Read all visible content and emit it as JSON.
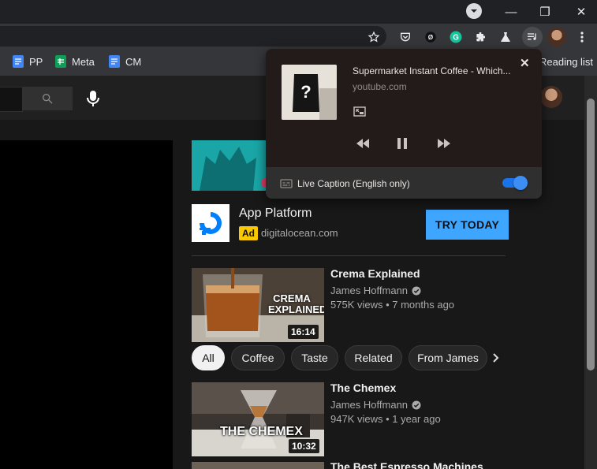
{
  "window": {
    "minimize": "—",
    "restore": "❐",
    "close": "✕"
  },
  "bookmarks": [
    {
      "label": "PP",
      "color": "#4285f4"
    },
    {
      "label": "Meta",
      "color": "#0f9d58"
    },
    {
      "label": "CM",
      "color": "#4285f4"
    }
  ],
  "reading_list": "Reading list",
  "media_popup": {
    "title": "Supermarket Instant Coffee - Which...",
    "source": "youtube.com",
    "live_caption_label": "Live Caption (English only)",
    "live_caption_on": true,
    "close": "✕"
  },
  "ad": {
    "title": "App Platform",
    "badge": "Ad",
    "domain": "digitalocean.com",
    "cta": "TRY TODAY"
  },
  "videos": [
    {
      "title": "Crema Explained",
      "channel": "James Hoffmann",
      "meta": "575K views • 7 months ago",
      "duration": "16:14",
      "overlay": "CREMA EXPLAINED"
    },
    {
      "title": "The Chemex",
      "channel": "James Hoffmann",
      "meta": "947K views • 1 year ago",
      "duration": "10:32",
      "overlay": "THE CHEMEX"
    },
    {
      "title": "The Best Espresso Machines"
    }
  ],
  "chips": [
    "All",
    "Coffee",
    "Taste",
    "Related",
    "From James"
  ],
  "colors": {
    "accent": "#3ea6ff",
    "toggle": "#1a73e8"
  }
}
